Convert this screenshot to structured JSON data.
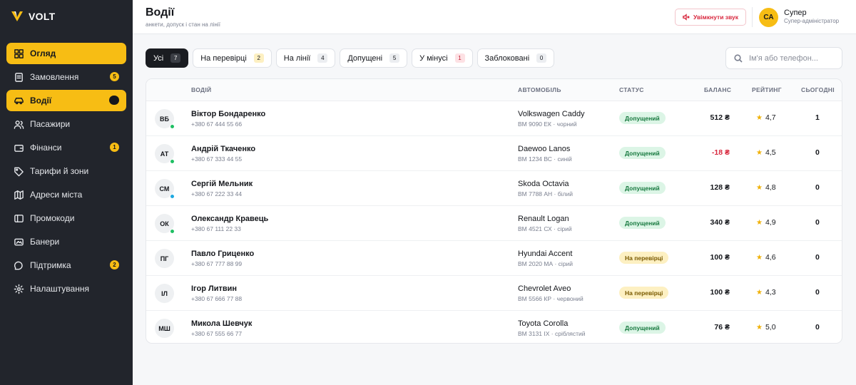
{
  "app": {
    "name": "VOLT"
  },
  "colors": {
    "accent": "#f7bd14",
    "sidebar": "#22252c",
    "danger": "#d8283e",
    "success": "#17793f"
  },
  "sidebar": {
    "items": [
      {
        "label": "Огляд",
        "icon": "grid-icon",
        "active": true,
        "badge": null
      },
      {
        "label": "Замовлення",
        "icon": "orders-icon",
        "active": false,
        "badge": "5"
      },
      {
        "label": "Водії",
        "icon": "car-icon",
        "active": true,
        "badge": ""
      },
      {
        "label": "Пасажири",
        "icon": "users-icon",
        "active": false,
        "badge": null
      },
      {
        "label": "Фінанси",
        "icon": "wallet-icon",
        "active": false,
        "badge": "1"
      },
      {
        "label": "Тарифи й зони",
        "icon": "tag-icon",
        "active": false,
        "badge": null
      },
      {
        "label": "Адреси міста",
        "icon": "map-icon",
        "active": false,
        "badge": null
      },
      {
        "label": "Промокоди",
        "icon": "promo-icon",
        "active": false,
        "badge": null
      },
      {
        "label": "Банери",
        "icon": "banner-icon",
        "active": false,
        "badge": null
      },
      {
        "label": "Підтримка",
        "icon": "chat-icon",
        "active": false,
        "badge": "2"
      },
      {
        "label": "Налаштування",
        "icon": "gear-icon",
        "active": false,
        "badge": null
      }
    ]
  },
  "header": {
    "title": "Водії",
    "subtitle": "анкети, допуск і стан на лінії",
    "sound_button": "Увімкнути звук",
    "user": {
      "initials": "СА",
      "name": "Супер",
      "role": "Супер-адміністратор"
    }
  },
  "filters": [
    {
      "label": "Усі",
      "count": "7",
      "active": true,
      "tone": "default"
    },
    {
      "label": "На перевірці",
      "count": "2",
      "active": false,
      "tone": "yellow"
    },
    {
      "label": "На лінії",
      "count": "4",
      "active": false,
      "tone": "default"
    },
    {
      "label": "Допущені",
      "count": "5",
      "active": false,
      "tone": "default"
    },
    {
      "label": "У мінусі",
      "count": "1",
      "active": false,
      "tone": "red"
    },
    {
      "label": "Заблоковані",
      "count": "0",
      "active": false,
      "tone": "default"
    }
  ],
  "search": {
    "placeholder": "Ім'я або телефон..."
  },
  "table": {
    "columns": {
      "driver": "ВОДІЙ",
      "car": "АВТОМОБІЛЬ",
      "status": "СТАТУС",
      "balance": "БАЛАНС",
      "rating": "РЕЙТИНГ",
      "today": "СЬОГОДНІ"
    },
    "rows": [
      {
        "initials": "ВБ",
        "online": "#1fbf63",
        "name": "Віктор Бондаренко",
        "phone": "+380 67 444 55 66",
        "car": "Volkswagen Caddy",
        "plate": "ВМ 9090 ЕК · чорний",
        "status": "Допущений",
        "status_tone": "ok",
        "balance": "512 ₴",
        "negative": false,
        "rating": "4,7",
        "today": "1"
      },
      {
        "initials": "АТ",
        "online": "#1fbf63",
        "name": "Андрій Ткаченко",
        "phone": "+380 67 333 44 55",
        "car": "Daewoo Lanos",
        "plate": "ВМ 1234 ВС · синій",
        "status": "Допущений",
        "status_tone": "ok",
        "balance": "-18 ₴",
        "negative": true,
        "rating": "4,5",
        "today": "0"
      },
      {
        "initials": "СМ",
        "online": "#1fa8e0",
        "name": "Сергій Мельник",
        "phone": "+380 67 222 33 44",
        "car": "Skoda Octavia",
        "plate": "ВМ 7788 АН · білий",
        "status": "Допущений",
        "status_tone": "ok",
        "balance": "128 ₴",
        "negative": false,
        "rating": "4,8",
        "today": "0"
      },
      {
        "initials": "ОК",
        "online": "#1fbf63",
        "name": "Олександр Кравець",
        "phone": "+380 67 111 22 33",
        "car": "Renault Logan",
        "plate": "ВМ 4521 СХ · сірий",
        "status": "Допущений",
        "status_tone": "ok",
        "balance": "340 ₴",
        "negative": false,
        "rating": "4,9",
        "today": "0"
      },
      {
        "initials": "ПГ",
        "online": null,
        "name": "Павло Гриценко",
        "phone": "+380 67 777 88 99",
        "car": "Hyundai Accent",
        "plate": "ВМ 2020 МА · сірий",
        "status": "На перевірці",
        "status_tone": "rev",
        "balance": "100 ₴",
        "negative": false,
        "rating": "4,6",
        "today": "0"
      },
      {
        "initials": "ІЛ",
        "online": null,
        "name": "Ігор Литвин",
        "phone": "+380 67 666 77 88",
        "car": "Chevrolet Aveo",
        "plate": "ВМ 5566 КР · червоний",
        "status": "На перевірці",
        "status_tone": "rev",
        "balance": "100 ₴",
        "negative": false,
        "rating": "4,3",
        "today": "0"
      },
      {
        "initials": "МШ",
        "online": null,
        "name": "Микола Шевчук",
        "phone": "+380 67 555 66 77",
        "car": "Toyota Corolla",
        "plate": "ВМ 3131 ІХ · сріблястий",
        "status": "Допущений",
        "status_tone": "ok",
        "balance": "76 ₴",
        "negative": false,
        "rating": "5,0",
        "today": "0"
      }
    ]
  }
}
